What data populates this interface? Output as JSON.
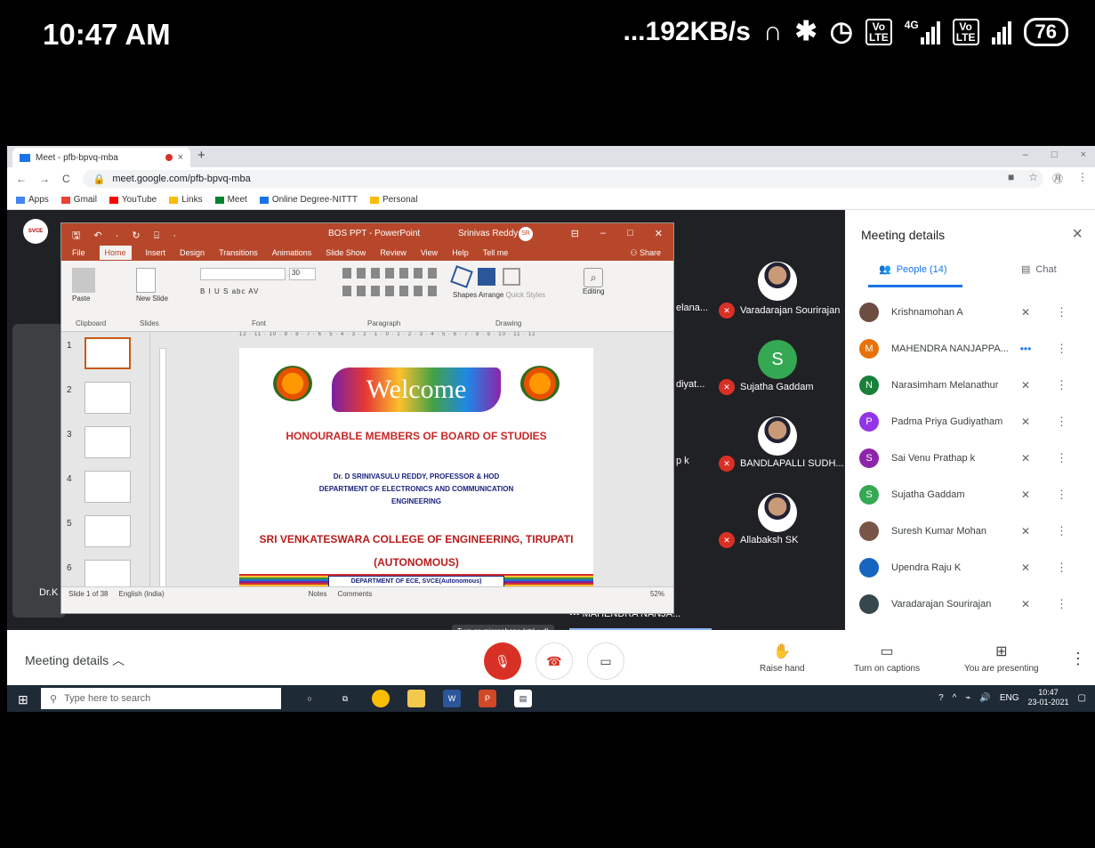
{
  "phone_status": {
    "time": "10:47 AM",
    "net_speed": "...192KB/s",
    "sim1": "4G",
    "volte_top": "Vo",
    "volte_bottom": "LTE",
    "battery": "76"
  },
  "browser": {
    "tab_title": "Meet - pfb-bpvq-mba",
    "tab_close": "×",
    "new_tab": "+",
    "window_controls": [
      "–",
      "□",
      "×"
    ],
    "nav": [
      "←",
      "→",
      "C"
    ],
    "url": "meet.google.com/pfb-bpvq-mba",
    "addr_icons": [
      "■",
      "☆",
      "㊊",
      "⋮"
    ],
    "bookmarks": [
      {
        "label": "Apps",
        "color": "#4285f4"
      },
      {
        "label": "Gmail",
        "color": "#ea4335"
      },
      {
        "label": "YouTube",
        "color": "#ff0000"
      },
      {
        "label": "Links",
        "color": "#fbbc04"
      },
      {
        "label": "Meet",
        "color": "#00832d"
      },
      {
        "label": "Online Degree-NITTT",
        "color": "#1a73e8"
      },
      {
        "label": "Personal",
        "color": "#fbbc04"
      }
    ]
  },
  "meet": {
    "logo_text": "SVCE",
    "left_tile_name": "Dr.K",
    "cut_names": [
      "elana...",
      "diyat...",
      "p k"
    ],
    "tiles": [
      {
        "name": "Varadarajan Sourirajan",
        "avatar": "photo"
      },
      {
        "name": "Sujatha Gaddam",
        "avatar": "letter",
        "letter": "S"
      },
      {
        "name": "BANDLAPALLI SUDH...",
        "avatar": "photo"
      },
      {
        "name": "Allabaksh SK",
        "avatar": "photo"
      }
    ],
    "bottom_tile": "MAHENDRA NANJA...",
    "bottom_tile_dots": "•••",
    "tooltip": "Turn on microphone (ctrl + d)",
    "controls": {
      "meeting_details": "Meeting details",
      "raise_hand": "Raise hand",
      "captions": "Turn on captions",
      "presenting": "You are presenting"
    }
  },
  "powerpoint": {
    "qat": "🖫 ↶ · ↻ ⌸ ·",
    "doc_title": "BOS PPT - PowerPoint",
    "user": "Srinivas Reddy",
    "user_initials": "SR",
    "window_controls": [
      "⊟",
      "–",
      "□",
      "✕"
    ],
    "tabs": [
      "File",
      "Home",
      "Insert",
      "Design",
      "Transitions",
      "Animations",
      "Slide Show",
      "Review",
      "View",
      "Help",
      "Tell me"
    ],
    "share": "Share",
    "ribbon_groups": {
      "paste": "Paste",
      "new_slide": "New Slide",
      "clipboard": "Clipboard",
      "slides": "Slides",
      "font": "Font",
      "paragraph": "Paragraph",
      "drawing": "Drawing",
      "shapes": "Shapes",
      "arrange": "Arrange",
      "quick_styles": "Quick Styles",
      "editing": "Editing"
    },
    "font_size": "30",
    "format_buttons": "B  I  U  S  abc  AV",
    "ruler": "12 · 11 · 10 · 9 · 8 · 7 · 6 · 5 · 4 · 3 · 2 · 1 · 0 · 1 · 2 · 3 · 4 · 5 · 6 · 7 · 8 · 9 · 10 · 11 · 12",
    "thumb_numbers": [
      "1",
      "2",
      "3",
      "4",
      "5",
      "6"
    ],
    "slide": {
      "welcome": "Welcome",
      "heading": "HONOURABLE MEMBERS OF BOARD OF STUDIES",
      "line1": "Dr. D SRINIVASULU REDDY, PROFESSOR & HOD",
      "line2": "DEPARTMENT OF ELECTRONICS AND COMMUNICATION",
      "line3": "ENGINEERING",
      "college": "SRI VENKATESWARA COLLEGE OF ENGINEERING, TIRUPATI",
      "autonomous": "(AUTONOMOUS)",
      "dept_bar": "DEPARTMENT OF ECE, SVCE(Autonomous)"
    },
    "status": {
      "slide_count": "Slide 1 of 38",
      "language": "English (India)",
      "notes": "Notes",
      "comments": "Comments",
      "zoom": "52%"
    }
  },
  "taskbar": {
    "search": "Type here to search",
    "lang": "ENG",
    "time": "10:47",
    "date": "23-01-2021"
  },
  "sidebar": {
    "title": "Meeting details",
    "close": "×",
    "tab_people": "People (14)",
    "tab_chat": "Chat",
    "participants": [
      {
        "name": "Krishnamohan A",
        "avatar": "photo",
        "color": "#6d4c41",
        "letter": ""
      },
      {
        "name": "MAHENDRA NANJAPPA...",
        "avatar": "letter",
        "color": "#e8710a",
        "letter": "M",
        "speaking": true
      },
      {
        "name": "Narasimham Melanathur",
        "avatar": "letter",
        "color": "#188038",
        "letter": "N"
      },
      {
        "name": "Padma Priya Gudiyatham",
        "avatar": "letter",
        "color": "#9334e6",
        "letter": "P"
      },
      {
        "name": "Sai Venu Prathap k",
        "avatar": "letter",
        "color": "#8e24aa",
        "letter": "S"
      },
      {
        "name": "Sujatha Gaddam",
        "avatar": "letter",
        "color": "#34a853",
        "letter": "S"
      },
      {
        "name": "Suresh Kumar Mohan",
        "avatar": "photo",
        "color": "#795548",
        "letter": ""
      },
      {
        "name": "Upendra Raju K",
        "avatar": "photo",
        "color": "#1565c0",
        "letter": ""
      },
      {
        "name": "Varadarajan Sourirajan",
        "avatar": "photo",
        "color": "#37474f",
        "letter": ""
      }
    ],
    "speaking_dots": "•••"
  }
}
